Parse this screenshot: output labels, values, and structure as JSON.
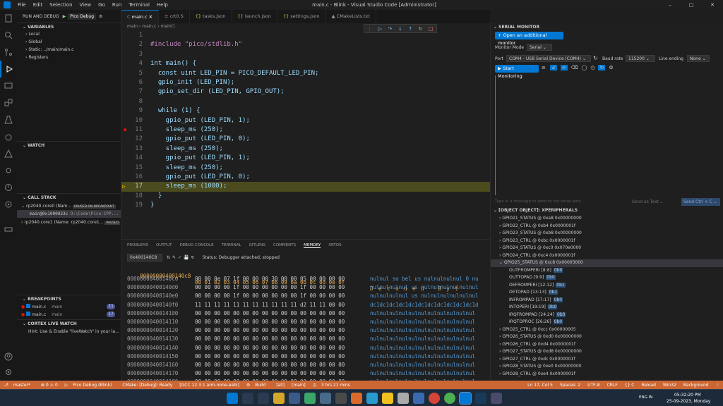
{
  "titlebar": {
    "menu": [
      "File",
      "Edit",
      "Selection",
      "View",
      "Go",
      "Run",
      "Terminal",
      "Help"
    ],
    "title": "main.c - Blink - Visual Studio Code [Administrator]"
  },
  "sidebar": {
    "header_title": "RUN AND DEBUG",
    "config": "Pico Debug",
    "variables_title": "VARIABLES",
    "variables": [
      "Local",
      "Global",
      "Static: ../main/main.c",
      "Registers"
    ],
    "watch_title": "WATCH",
    "callstack_title": "CALL STACK",
    "threads": [
      {
        "name": "rp2040.core0 (Nam...",
        "badge": "PAUSED ON BREAKPOINT"
      },
      {
        "frame": "main@0x1000033c",
        "path": "D:\\Code\\Pico-CPP..."
      },
      {
        "name": "rp2040.core1 (Name: rp2040.core1...",
        "badge": "PAUSED"
      }
    ],
    "breakpoints_title": "BREAKPOINTS",
    "breakpoints": [
      {
        "file": "main.c",
        "fn": "main",
        "count": "11"
      },
      {
        "file": "main.c",
        "fn": "main",
        "count": "17"
      }
    ],
    "cortex_title": "CORTEX LIVE WATCH",
    "cortex_hint": "Hint: Use & Enable \"liveWatch\" in your la..."
  },
  "tabs": [
    "main.c",
    "crt0.S",
    "tasks.json",
    "launch.json",
    "settings.json",
    "CMakeLists.txt"
  ],
  "breadcrumb": [
    "main",
    "main.c",
    "main()"
  ],
  "editor": {
    "lines": [
      {
        "n": "1",
        "t": ""
      },
      {
        "n": "2",
        "t": "#include \"pico/stdlib.h\""
      },
      {
        "n": "3",
        "t": ""
      },
      {
        "n": "4",
        "t": "int main() {"
      },
      {
        "n": "5",
        "t": "  const uint LED_PIN = PICO_DEFAULT_LED_PIN;"
      },
      {
        "n": "6",
        "t": "  gpio_init (LED_PIN);"
      },
      {
        "n": "7",
        "t": "  gpio_set_dir (LED_PIN, GPIO_OUT);"
      },
      {
        "n": "8",
        "t": ""
      },
      {
        "n": "9",
        "t": "  while (1) {"
      },
      {
        "n": "10",
        "t": "    gpio_put (LED_PIN, 1);"
      },
      {
        "n": "11",
        "t": "    sleep_ms (250);"
      },
      {
        "n": "12",
        "t": "    gpio_put (LED_PIN, 0);"
      },
      {
        "n": "13",
        "t": "    sleep_ms (250);"
      },
      {
        "n": "14",
        "t": "    gpio_put (LED_PIN, 1);"
      },
      {
        "n": "15",
        "t": "    sleep_ms (250);"
      },
      {
        "n": "16",
        "t": "    gpio_put (LED_PIN, 0);"
      },
      {
        "n": "17",
        "t": "    sleep_ms (1000);"
      },
      {
        "n": "18",
        "t": "  }"
      },
      {
        "n": "19",
        "t": "}"
      }
    ]
  },
  "panel": {
    "tabs": [
      "PROBLEMS",
      "OUTPUT",
      "DEBUG CONSOLE",
      "TERMINAL",
      "GITLENS",
      "COMMENTS",
      "MEMORY",
      "XRTOS"
    ],
    "address": "0x400140C8",
    "status": "Status: Debugger attached, stopped",
    "header_addr": "00000000400140c8",
    "header_bytes": "00 01 02 03 04 05 06 07 08 09 0a 0b 0c 0d 0e 0f",
    "header_decoded": "D e c o d e d   B y t",
    "rows": [
      {
        "a": "00000000400140c0",
        "b": "00 00 0e 07 1f 00 00 00 30 00 00 05 00 00 00 00",
        "d": "nulnul so bel us nulnulnulnul 0 nu"
      },
      {
        "a": "00000000400140d0",
        "b": "00 00 00 00 1f 00 00 00 00 00 00 1f 00 00 00 00",
        "d": "nulnulnulnul us nulnulnulnulnulnul"
      },
      {
        "a": "00000000400140e0",
        "b": "00 00 00 00 1f 00 00 00 00 00 00 1f 00 00 00 00",
        "d": "nulnulnulnul us nulnulnulnulnulnul"
      },
      {
        "a": "00000000400140f0",
        "b": "11 11 11 11 11 11 11 11 11 11 11 d2 11 11 00 00",
        "d": "dc1dc1dc1dc1dc1dc1dc1dc1dc1dc1dc1d"
      },
      {
        "a": "0000000040014100",
        "b": "00 00 00 00 00 00 00 00 00 00 00 00 00 00 00 00",
        "d": "nulnulnulnulnulnulnulnulnulnulnul"
      },
      {
        "a": "0000000040014110",
        "b": "00 00 00 00 00 00 00 00 00 00 00 00 00 00 00 00",
        "d": "nulnulnulnulnulnulnulnulnulnulnul"
      },
      {
        "a": "0000000040014120",
        "b": "00 00 00 00 00 00 00 00 00 00 00 00 00 00 00 00",
        "d": "nulnulnulnulnulnulnulnulnulnulnul"
      },
      {
        "a": "0000000040014130",
        "b": "00 00 00 00 00 00 00 00 00 00 00 00 00 00 00 00",
        "d": "nulnulnulnulnulnulnulnulnulnulnul"
      },
      {
        "a": "0000000040014140",
        "b": "00 00 00 00 00 00 00 00 00 00 00 00 00 00 00 00",
        "d": "nulnulnulnulnulnulnulnulnulnulnul"
      },
      {
        "a": "0000000040014150",
        "b": "00 00 00 00 00 00 00 00 00 00 00 00 00 00 00 00",
        "d": "nulnulnulnulnulnulnulnulnulnulnul"
      },
      {
        "a": "0000000040014160",
        "b": "00 00 00 00 00 00 00 00 00 00 00 00 00 00 00 00",
        "d": "nulnulnulnulnulnulnulnulnulnulnul"
      },
      {
        "a": "0000000040014170",
        "b": "00 00 00 00 00 00 00 00 00 00 00 00 00 00 00 00",
        "d": "nulnulnulnulnulnulnulnulnulnulnul"
      },
      {
        "a": "0000000040014180",
        "b": "00 00 00 00 00 00 00 00 00 00 00 00 00 00 00 00",
        "d": "nulnulnulnulnulnulnulnulnulnulnul"
      }
    ]
  },
  "serial": {
    "title": "SERIAL MONITOR",
    "open_btn": "Open an additional monitor",
    "mode_label": "Monitor Mode",
    "mode": "Serial",
    "port_label": "Port",
    "port": "COM4 - USB Serial Device (COM4)",
    "baud_label": "Baud rate",
    "baud": "115200",
    "ending_label": "Line ending",
    "ending": "None",
    "start_btn": "Start Monitoring",
    "input_placeholder": "Type in a message to send to the serial port.",
    "send_as": "Send as Text",
    "send_btn": "Send Ctrl + C"
  },
  "peripherals": {
    "title": "[OBJECT OBJECT]: XPERIPHERALS",
    "items": [
      {
        "t": "GPIO21_STATUS @ 0xa8 0x00000000",
        "lvl": 1
      },
      {
        "t": "GPIO22_CTRL @ 0xb4 0x0000001f",
        "lvl": 1
      },
      {
        "t": "GPIO23_STATUS @ 0xb8 0x00000000",
        "lvl": 1
      },
      {
        "t": "GPIO23_CTRL @ 0xbc 0x0000001f",
        "lvl": 1
      },
      {
        "t": "GPIO24_STATUS @ 0xc0 0x070e0000",
        "lvl": 1
      },
      {
        "t": "GPIO24_CTRL @ 0xc4 0x0000001f",
        "lvl": 1
      },
      {
        "t": "GPIO25_STATUS @ 0xc8 0x00003000",
        "lvl": 1,
        "open": true,
        "sel": true
      },
      {
        "t": "OUTFROMPERI [8:8]",
        "v": "0b0",
        "lvl": 2
      },
      {
        "t": "OUTTOPAD [9:9]",
        "v": "0b0",
        "lvl": 2
      },
      {
        "t": "OEFROMPERI [12:12]",
        "v": "0b1",
        "lvl": 2
      },
      {
        "t": "OETOPAD [13:13]",
        "v": "0b1",
        "lvl": 2
      },
      {
        "t": "INFROMPAD [17:17]",
        "v": "0b0",
        "lvl": 2
      },
      {
        "t": "INTOPERI [19:19]",
        "v": "0b0",
        "lvl": 2
      },
      {
        "t": "IRQFROMPAD [24:24]",
        "v": "0b0",
        "lvl": 2
      },
      {
        "t": "IRQTOPROC [26:26]",
        "v": "0b0",
        "lvl": 2
      },
      {
        "t": "GPIO25_CTRL @ 0xcc 0x00000005",
        "lvl": 1
      },
      {
        "t": "GPIO26_STATUS @ 0xd0 0x00000000",
        "lvl": 1
      },
      {
        "t": "GPIO26_CTRL @ 0xd4 0x0000001f",
        "lvl": 1
      },
      {
        "t": "GPIO27_STATUS @ 0xd8 0x00000000",
        "lvl": 1
      },
      {
        "t": "GPIO27_CTRL @ 0xdc 0x0000001f",
        "lvl": 1
      },
      {
        "t": "GPIO28_STATUS @ 0xe0 0x00000000",
        "lvl": 1
      },
      {
        "t": "GPIO28_CTRL @ 0xe4 0x0000001f",
        "lvl": 1
      }
    ]
  },
  "statusbar": {
    "left": [
      "master*",
      "⊗ 0 ⚠ 0",
      "Pico Debug (Blink)",
      "CMake: [Debug]: Ready",
      "[GCC 12.3.1 arm-none-eabi]",
      "Build",
      "[all]",
      "[main]",
      "3 hrs 21 mins"
    ],
    "right": [
      "Ln 17, Col 5",
      "Spaces: 2",
      "UTF-8",
      "CRLF",
      "{} C",
      "Reload",
      "Win32",
      "Background"
    ]
  },
  "taskbar": {
    "lang": "ENG IN",
    "time": "05:32:20 PM",
    "date": "25-09-2023, Monday"
  },
  "colors": {
    "accent": "#0078d4",
    "status": "#cc6633",
    "current_line": "#4b4b1e"
  }
}
